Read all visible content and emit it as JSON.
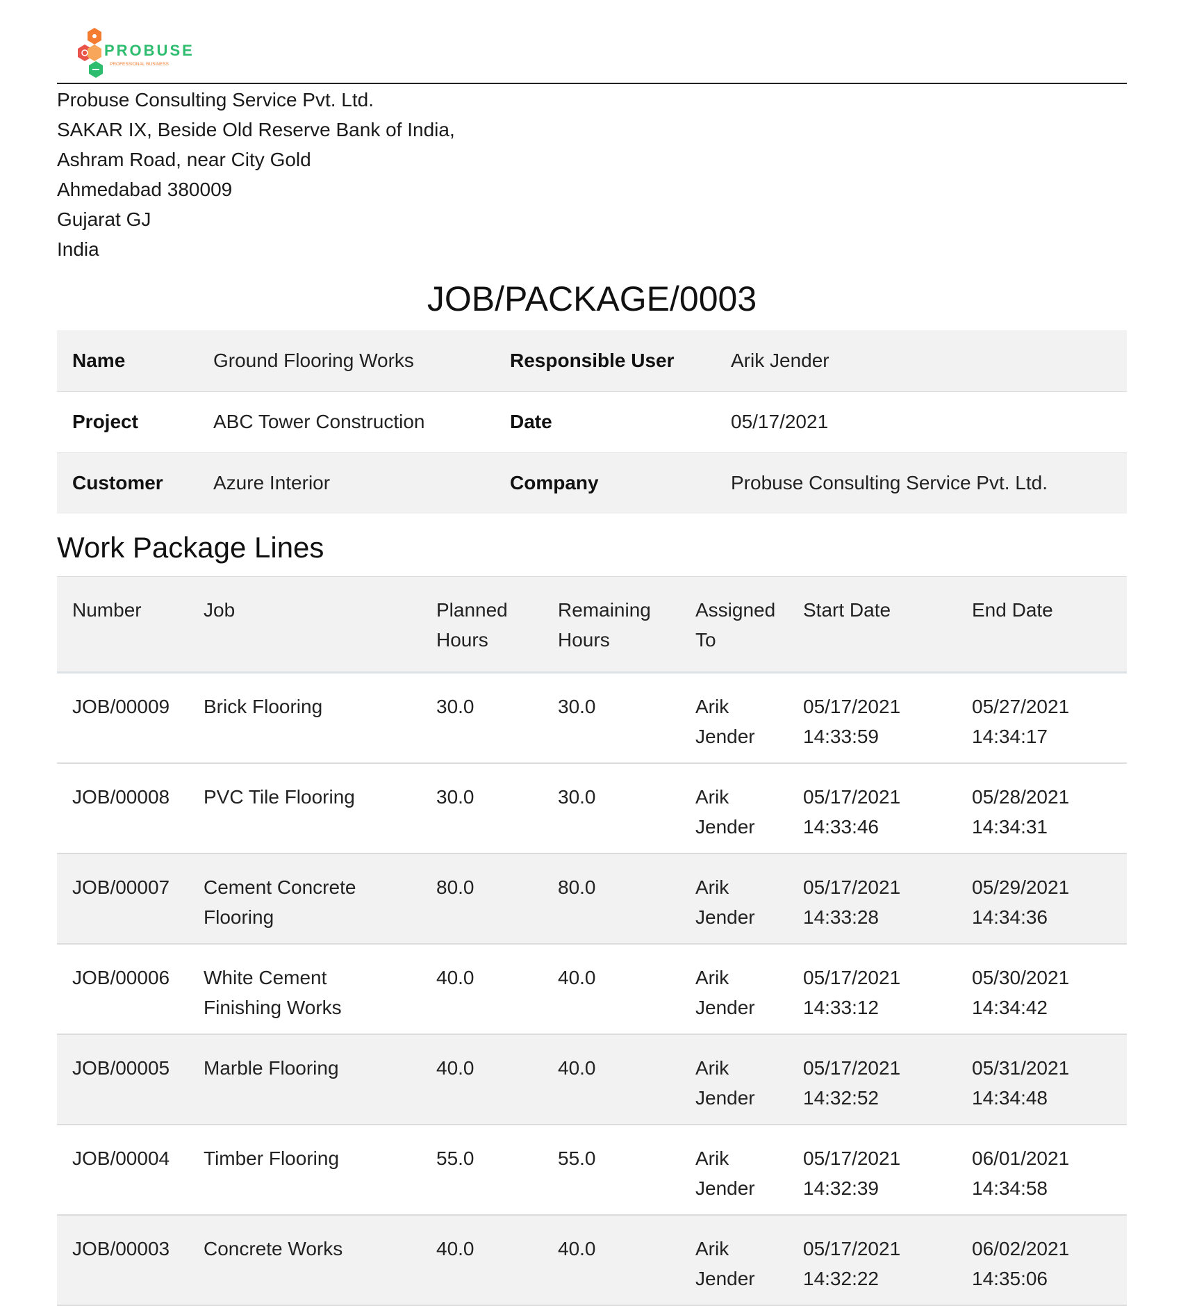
{
  "company": {
    "logo_text": "PROBUSE",
    "logo_tagline": "PROFESSIONAL BUSINESS",
    "name": "Probuse Consulting Service Pvt. Ltd.",
    "address_lines": [
      "SAKAR IX, Beside Old Reserve Bank of India,",
      "Ashram Road, near City Gold",
      "Ahmedabad 380009",
      "Gujarat GJ",
      "India"
    ]
  },
  "document": {
    "title": "JOB/PACKAGE/0003"
  },
  "info": {
    "name_label": "Name",
    "name_value": "Ground Flooring Works",
    "responsible_user_label": "Responsible User",
    "responsible_user_value": "Arik Jender",
    "project_label": "Project",
    "project_value": "ABC Tower Construction",
    "date_label": "Date",
    "date_value": "05/17/2021",
    "customer_label": "Customer",
    "customer_value": "Azure Interior",
    "company_label": "Company",
    "company_value": "Probuse Consulting Service Pvt. Ltd."
  },
  "lines": {
    "section_title": "Work Package Lines",
    "headers": {
      "number": "Number",
      "job": "Job",
      "planned_hours_1": "Planned",
      "planned_hours_2": "Hours",
      "remaining_hours_1": "Remaining",
      "remaining_hours_2": "Hours",
      "assigned_to_1": "Assigned",
      "assigned_to_2": "To",
      "start_date": "Start Date",
      "end_date": "End Date"
    },
    "rows": [
      {
        "number": "JOB/00009",
        "job_1": "Brick Flooring",
        "job_2": "",
        "planned": "30.0",
        "remaining": "30.0",
        "assigned_1": "Arik",
        "assigned_2": "Jender",
        "start_date": "05/17/2021",
        "start_time": "14:33:59",
        "end_date": "05/27/2021",
        "end_time": "14:34:17"
      },
      {
        "number": "JOB/00008",
        "job_1": "PVC Tile Flooring",
        "job_2": "",
        "planned": "30.0",
        "remaining": "30.0",
        "assigned_1": "Arik",
        "assigned_2": "Jender",
        "start_date": "05/17/2021",
        "start_time": "14:33:46",
        "end_date": "05/28/2021",
        "end_time": "14:34:31"
      },
      {
        "number": "JOB/00007",
        "job_1": "Cement Concrete",
        "job_2": "Flooring",
        "planned": "80.0",
        "remaining": "80.0",
        "assigned_1": "Arik",
        "assigned_2": "Jender",
        "start_date": "05/17/2021",
        "start_time": "14:33:28",
        "end_date": "05/29/2021",
        "end_time": "14:34:36"
      },
      {
        "number": "JOB/00006",
        "job_1": "White Cement",
        "job_2": "Finishing Works",
        "planned": "40.0",
        "remaining": "40.0",
        "assigned_1": "Arik",
        "assigned_2": "Jender",
        "start_date": "05/17/2021",
        "start_time": "14:33:12",
        "end_date": "05/30/2021",
        "end_time": "14:34:42"
      },
      {
        "number": "JOB/00005",
        "job_1": "Marble Flooring",
        "job_2": "",
        "planned": "40.0",
        "remaining": "40.0",
        "assigned_1": "Arik",
        "assigned_2": "Jender",
        "start_date": "05/17/2021",
        "start_time": "14:32:52",
        "end_date": "05/31/2021",
        "end_time": "14:34:48"
      },
      {
        "number": "JOB/00004",
        "job_1": "Timber Flooring",
        "job_2": "",
        "planned": "55.0",
        "remaining": "55.0",
        "assigned_1": "Arik",
        "assigned_2": "Jender",
        "start_date": "05/17/2021",
        "start_time": "14:32:39",
        "end_date": "06/01/2021",
        "end_time": "14:34:58"
      },
      {
        "number": "JOB/00003",
        "job_1": "Concrete Works",
        "job_2": "",
        "planned": "40.0",
        "remaining": "40.0",
        "assigned_1": "Arik",
        "assigned_2": "Jender",
        "start_date": "05/17/2021",
        "start_time": "14:32:22",
        "end_date": "06/02/2021",
        "end_time": "14:35:06"
      }
    ]
  },
  "colors": {
    "row_shade": "#f2f2f2",
    "logo_orange": "#f47c30",
    "logo_red": "#e8534a",
    "logo_green": "#2ebd6e"
  }
}
